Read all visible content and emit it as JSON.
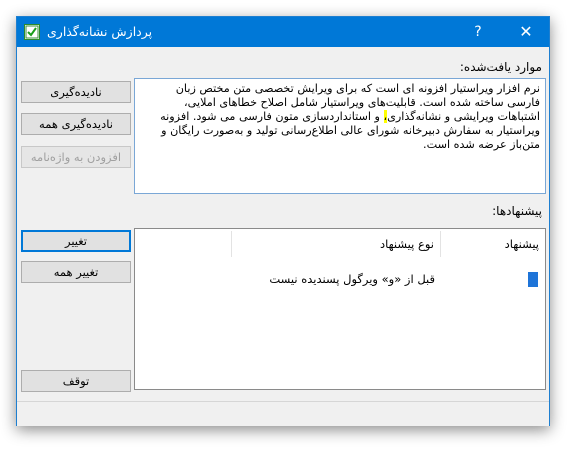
{
  "window": {
    "title": "پردازش نشانه‌گذاری",
    "help_label": "?",
    "close_label": "✕"
  },
  "found": {
    "label": "موارد یافت‌شده:",
    "text_before": "نرم افزار ویراستیار افزونه ای است که برای ویرایش تخصصی متن مختص زبان فارسی ساخته شده است. قابلیت‌های ویراستیار شامل اصلاح خطاهای املایی، اشتباهات ویرایشی و نشانه‌گذاری",
    "text_highlight": "،",
    "text_after": " و استانداردسازی متون فارسی می شود. افزونه ویراستیار به سفارش دبیرخانه شورای عالی اطلاع‌رسانی تولید و به‌صورت رایگان و متن‌باز عرضه شده است."
  },
  "suggestions": {
    "label": "پیشنهادها:",
    "columns": [
      "پیشنهاد",
      "نوع پیشنهاد"
    ],
    "rows": [
      {
        "type": "قبل از «و» ویرگول پسندیده نیست"
      }
    ]
  },
  "buttons": {
    "ignore": "نادیده‌گیری",
    "ignore_all": "نادیده‌گیری همه",
    "add_to_dictionary": "افزودن به واژه‌نامه",
    "change": "تغییر",
    "change_all": "تغییر همه",
    "stop": "توقف"
  },
  "colors": {
    "titlebar": "#0078d7",
    "highlight": "#ffff00",
    "selection_marker": "#1e74d8"
  },
  "icons": {
    "app": "checkmark-document-icon"
  }
}
